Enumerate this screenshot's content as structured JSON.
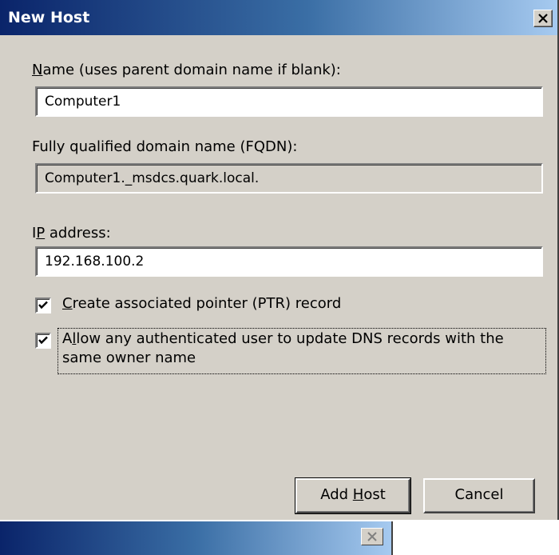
{
  "window": {
    "title": "New Host",
    "close_icon": "close-icon"
  },
  "name_field": {
    "label_access_key": "N",
    "label_rest": "ame (uses parent domain name if blank):",
    "value": "Computer1"
  },
  "fqdn_field": {
    "label": "Fully qualified domain name (FQDN):",
    "value": "Computer1._msdcs.quark.local."
  },
  "ip_field": {
    "label_before": "I",
    "label_access_key": "P",
    "label_rest": " address:",
    "value": "192.168.100.2"
  },
  "ptr_checkbox": {
    "checked": true,
    "label_access_key": "C",
    "label_rest": "reate associated pointer (PTR) record"
  },
  "update_checkbox": {
    "checked": true,
    "label_before": "A",
    "label_access_key": "l",
    "label_rest": "low any authenticated user to update DNS records with the same owner name"
  },
  "buttons": {
    "add_host_before": "Add ",
    "add_host_access_key": "H",
    "add_host_rest": "ost",
    "cancel": "Cancel"
  },
  "colors": {
    "dialog_bg": "#d4d0c8",
    "title_start": "#0a246a",
    "title_end": "#a6caf0"
  }
}
